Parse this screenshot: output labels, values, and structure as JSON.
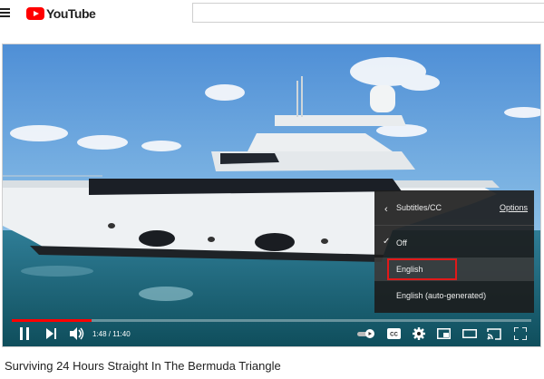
{
  "header": {
    "logo_text": "YouTube",
    "search_placeholder": ""
  },
  "video": {
    "title": "Surviving 24 Hours Straight In The Bermuda Triangle"
  },
  "player": {
    "current_time": "1:48",
    "duration": "11:40",
    "time_display": "1:48 / 11:40",
    "progress_fraction": 0.154,
    "accent_color": "#ff0000"
  },
  "subtitles_menu": {
    "title": "Subtitles/CC",
    "options_link": "Options",
    "items": [
      {
        "label": "Off",
        "checked": true
      },
      {
        "label": "English",
        "checked": false,
        "highlighted": true
      },
      {
        "label": "English (auto-generated)",
        "checked": false
      }
    ],
    "highlight_color": "#e11919"
  },
  "icons": [
    "menu-icon",
    "youtube-logo-icon",
    "pause-icon",
    "next-icon",
    "volume-icon",
    "autoplay-toggle-icon",
    "captions-icon",
    "settings-icon",
    "miniplayer-icon",
    "theater-icon",
    "cast-icon",
    "fullscreen-icon",
    "back-chevron-icon",
    "check-icon"
  ]
}
